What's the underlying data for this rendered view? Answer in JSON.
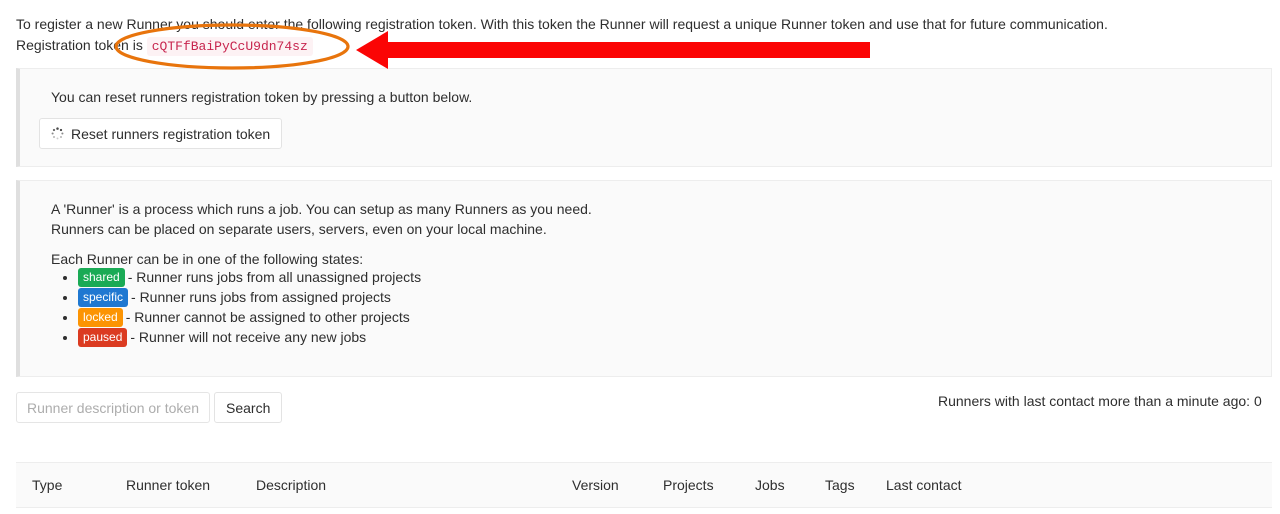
{
  "intro": {
    "line1": "To register a new Runner you should enter the following registration token. With this token the Runner will request a unique Runner token and use that for future communication.",
    "line2_prefix": "Registration token is",
    "registration_token": "cQTFfBaiPyCcU9dn74sz"
  },
  "reset_panel": {
    "description": "You can reset runners registration token by pressing a button below.",
    "button_label": "Reset runners registration token",
    "button_icon": "spinner-icon"
  },
  "info_panel": {
    "line1": "A 'Runner' is a process which runs a job. You can setup as many Runners as you need.",
    "line2": "Runners can be placed on separate users, servers, even on your local machine.",
    "line3": "Each Runner can be in one of the following states:",
    "states": [
      {
        "badge": "shared",
        "color": "#1aaa55",
        "description": "- Runner runs jobs from all unassigned projects"
      },
      {
        "badge": "specific",
        "color": "#1f78d1",
        "description": "- Runner runs jobs from assigned projects"
      },
      {
        "badge": "locked",
        "color": "#fc9403",
        "description": "- Runner cannot be assigned to other projects"
      },
      {
        "badge": "paused",
        "color": "#db3b21",
        "description": "- Runner will not receive any new jobs"
      }
    ]
  },
  "search": {
    "value": "",
    "placeholder": "Runner description or token",
    "button_label": "Search"
  },
  "status": {
    "stale_contact_text": "Runners with last contact more than a minute ago: 0"
  },
  "table": {
    "columns": [
      "Type",
      "Runner token",
      "Description",
      "Version",
      "Projects",
      "Jobs",
      "Tags",
      "Last contact"
    ]
  },
  "annotation": {
    "arrow_color": "#fb0505",
    "ellipse_color": "#e8740c"
  }
}
